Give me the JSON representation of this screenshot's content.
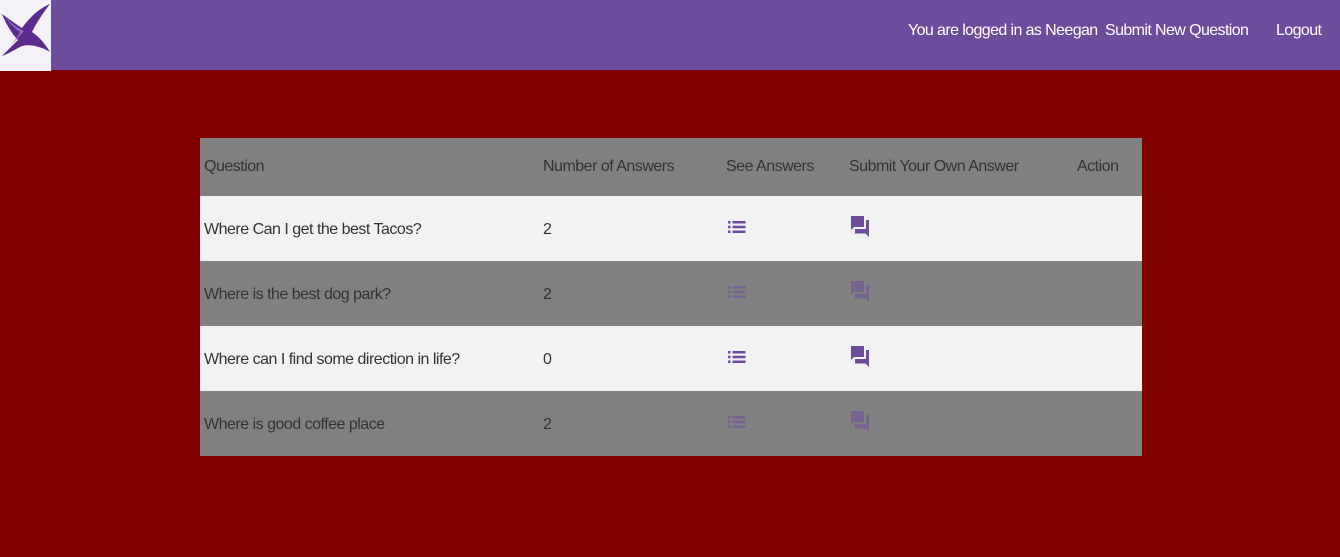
{
  "nav": {
    "logo_icon": "bird-logo-icon",
    "user_text": "You are logged in as Neegan",
    "submit_label": "Submit New Question",
    "logout_label": "Logout"
  },
  "colors": {
    "navbar": "#6e4c9c",
    "page_background": "#800000",
    "header_row": "#808080",
    "row_light": "#f2f2f2",
    "row_dark": "#808080",
    "icon": "#6e4c9c"
  },
  "table": {
    "headers": {
      "question": "Question",
      "count": "Number of Answers",
      "see": "See Answers",
      "submit": "Submit Your Own Answer",
      "action": "Action"
    },
    "rows": [
      {
        "question": "Where Can I get the best Tacos?",
        "count": "2",
        "see_icon": "list-icon",
        "answer_icon": "forum-icon"
      },
      {
        "question": "Where is the best dog park?",
        "count": "2",
        "see_icon": "list-icon",
        "answer_icon": "forum-icon"
      },
      {
        "question": "Where can I find some direction in life?",
        "count": "0",
        "see_icon": "list-icon",
        "answer_icon": "forum-icon"
      },
      {
        "question": "Where is good coffee place",
        "count": "2",
        "see_icon": "list-icon",
        "answer_icon": "forum-icon"
      }
    ]
  }
}
